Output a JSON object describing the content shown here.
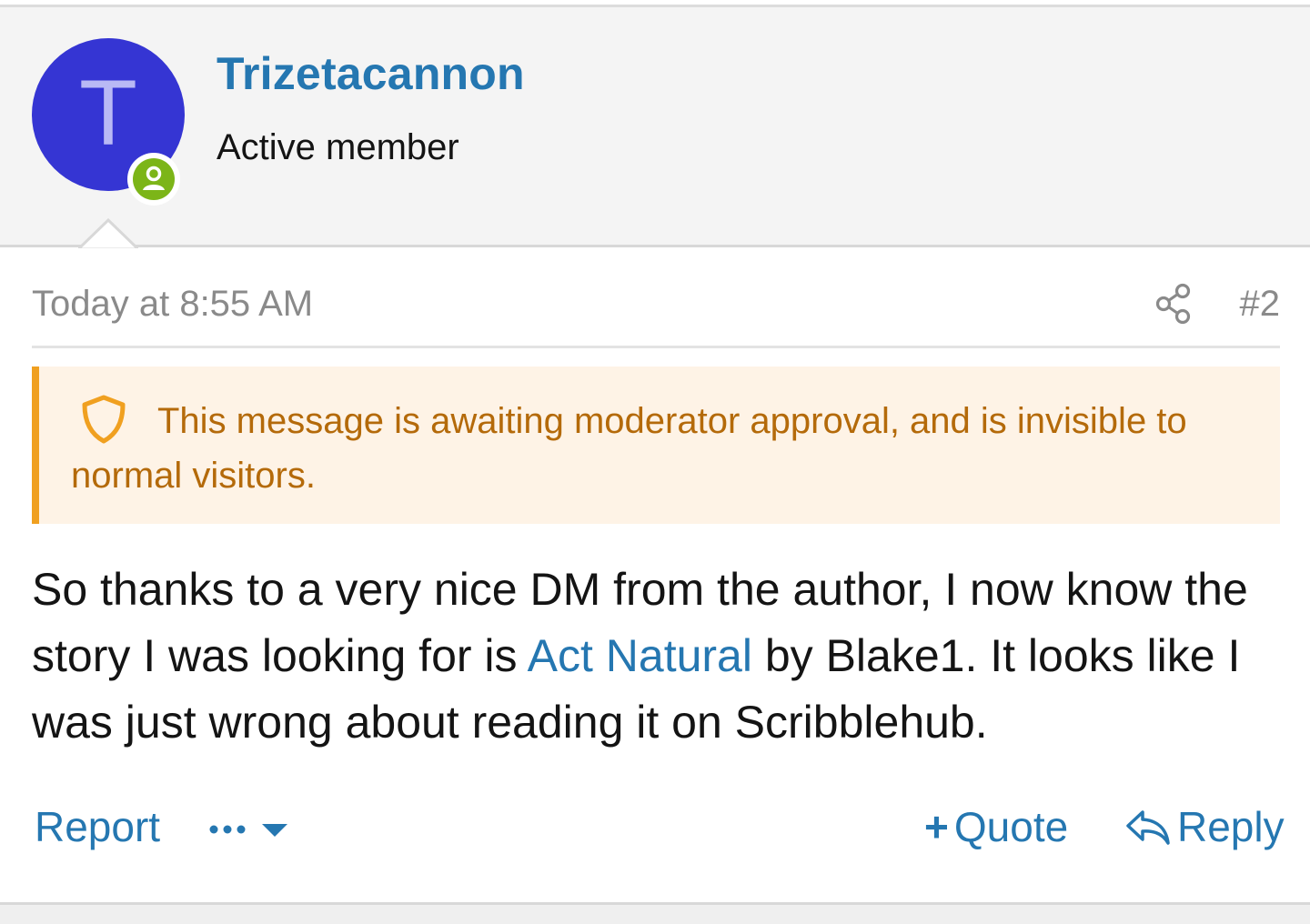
{
  "user": {
    "avatar_letter": "T",
    "username": "Trizetacannon",
    "title": "Active member",
    "status": "online"
  },
  "post": {
    "date": "Today at 8:55 AM",
    "number": "#2",
    "moderation_notice": "This message is awaiting moderator approval, and is invisible to normal visitors.",
    "body": {
      "before_link": "So thanks to a very nice DM from the author, I now know the story I was looking for is ",
      "link_text": "Act Natural",
      "after_link": " by Blake1. It looks like I was just wrong about reading it on Scribblehub."
    }
  },
  "actions": {
    "report_label": "Report",
    "more_label": "•••",
    "quote_label": "Quote",
    "reply_label": "Reply"
  },
  "colors": {
    "link_blue": "#2577b1",
    "avatar_bg": "#3535d3",
    "online_green": "#7cb518",
    "notice_bg": "#fef3e6",
    "notice_border": "#f0a020",
    "notice_text": "#b46a0a"
  },
  "icons": {
    "share": "share-icon",
    "shield": "shield-icon",
    "online": "user-online-icon",
    "more_caret": "caret-down-icon",
    "reply": "reply-arrow-icon",
    "quote": "plus-icon"
  }
}
